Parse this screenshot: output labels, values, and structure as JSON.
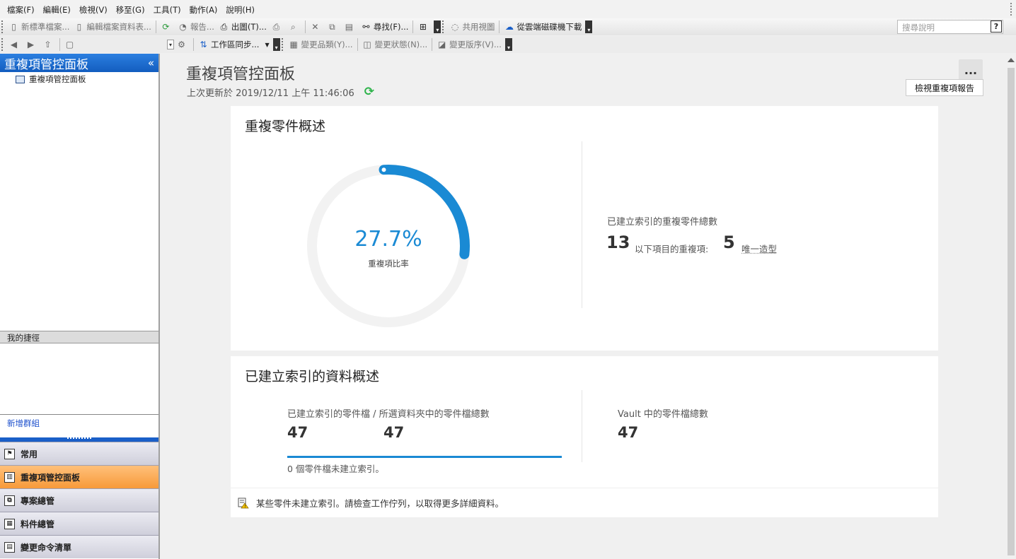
{
  "menu": [
    "檔案(F)",
    "編輯(E)",
    "檢視(V)",
    "移至(G)",
    "工具(T)",
    "動作(A)",
    "說明(H)"
  ],
  "toolbar1": {
    "new_std": "新標準檔案...",
    "edit_props": "編輯檔案資料表...",
    "report": "報告...",
    "print": "出圖(T)...",
    "find": "尋找(F)...",
    "shared_view": "共用視圖",
    "cloud_download": "從雲端磁碟機下載"
  },
  "search": {
    "placeholder": "搜尋說明",
    "help": "?"
  },
  "toolbar2": {
    "workspace_sync": "工作區同步...",
    "change_category": "變更品類(Y)...",
    "change_state": "變更狀態(N)...",
    "change_revision": "變更版序(V)..."
  },
  "left_panel": {
    "title": "重複項管控面板",
    "collapse": "«",
    "tree_item": "重複項管控面板",
    "shortcuts_header": "我的捷徑",
    "add_group": "新增群組",
    "nav": [
      "常用",
      "重複項管控面板",
      "專案總管",
      "料件總管",
      "變更命令清單"
    ]
  },
  "main": {
    "title": "重複項管控面板",
    "updated": "上次更新於 2019/12/11 上午 11:46:06",
    "more": "...",
    "tooltip": "檢視重複項報告"
  },
  "card1": {
    "title": "重複零件概述",
    "ratio_value": "27.7%",
    "ratio_fraction": 0.277,
    "ratio_label": "重複項比率",
    "total_label": "已建立索引的重複零件總數",
    "dup_count": "13",
    "dup_text": "以下項目的重複項:",
    "unique_count": "5",
    "unique_text": "唯一造型"
  },
  "card2": {
    "title": "已建立索引的資料概述",
    "indexed_label": "已建立索引的零件檔 / 所選資料夾中的零件檔總數",
    "indexed": "47",
    "selected_total": "47",
    "not_indexed": "0  個零件檔未建立索引。",
    "vault_label": "Vault 中的零件檔總數",
    "vault_total": "47",
    "warning": "某些零件未建立索引。請檢查工作佇列，以取得更多詳細資料。"
  },
  "colors": {
    "accent": "#1a8ad4",
    "nav_active": "#f79a3a",
    "header_blue": "#1e6cd6"
  }
}
